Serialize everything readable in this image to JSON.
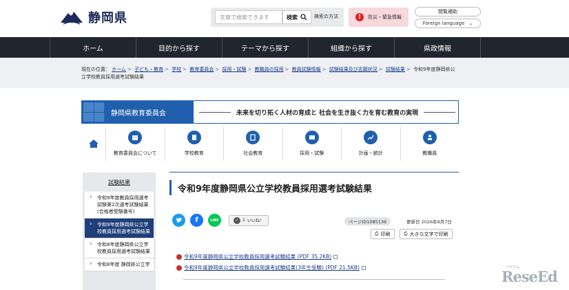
{
  "header": {
    "logo_text": "静岡県",
    "search": {
      "placeholder": "文章で検索できます",
      "button_label": "検索",
      "help_label": "検索の方法"
    },
    "emergency_label": "防災・緊急情報",
    "help_label": "閲覧補助",
    "language_label": "Foreign language"
  },
  "nav": {
    "items": [
      "ホーム",
      "目的から探す",
      "テーマから探す",
      "組織から探す",
      "県政情報"
    ]
  },
  "breadcrumb": {
    "prefix": "現在の位置：",
    "links": [
      "ホーム",
      "子ども・教育",
      "学校",
      "教育委員会",
      "採用・試験",
      "教職員の採用",
      "教員試験情報",
      "試験結果及び志願状況",
      "試験結果"
    ],
    "current": "令和9年度静岡県公立学校教員採用選考試験結果"
  },
  "board_banner": {
    "name": "静岡県教育委員会",
    "tagline": "未来を切り拓く人材の育成と 社会を生き抜く力を育む教育の実現"
  },
  "board_nav": {
    "items": [
      "教育委員会について",
      "学校教育",
      "社会教育",
      "採用・試験",
      "計画・統計",
      "教職員"
    ]
  },
  "side_menu": {
    "title": "試験結果",
    "items": [
      {
        "label": "令和9年度教員採用選考試験第2次選考試験結果(合格者受験番号)",
        "active": false
      },
      {
        "label": "令和9年度静岡県公立学校教員採用選考試験結果",
        "active": true
      },
      {
        "label": "令和8年度静岡県公立学校教員採用選考試験結果",
        "active": false
      },
      {
        "label": "令和8年度 静岡県公立学",
        "active": false
      }
    ]
  },
  "main": {
    "title": "令和9年度静岡県公立学校教員採用選考試験結果",
    "like_label": "いいね！",
    "like_count": "1",
    "page_id": "ページID1085136",
    "updated": "更新日 2026年8月7日",
    "print_label": "印刷",
    "big_text_label": "大きな文字で印刷",
    "links": [
      "令和9年度静岡県公立学校教員採用選考試験結果 (PDF 35.2KB)",
      "令和9年度静岡県公立学校教員採用選考試験結果(3年生受験) (PDF 21.5KB)"
    ]
  },
  "social": {
    "twitter_color": "#1d9bf0",
    "facebook_color": "#1877f2",
    "line_color": "#06c755"
  },
  "watermark": {
    "text": "ReseEd",
    "small": "リセマム"
  }
}
